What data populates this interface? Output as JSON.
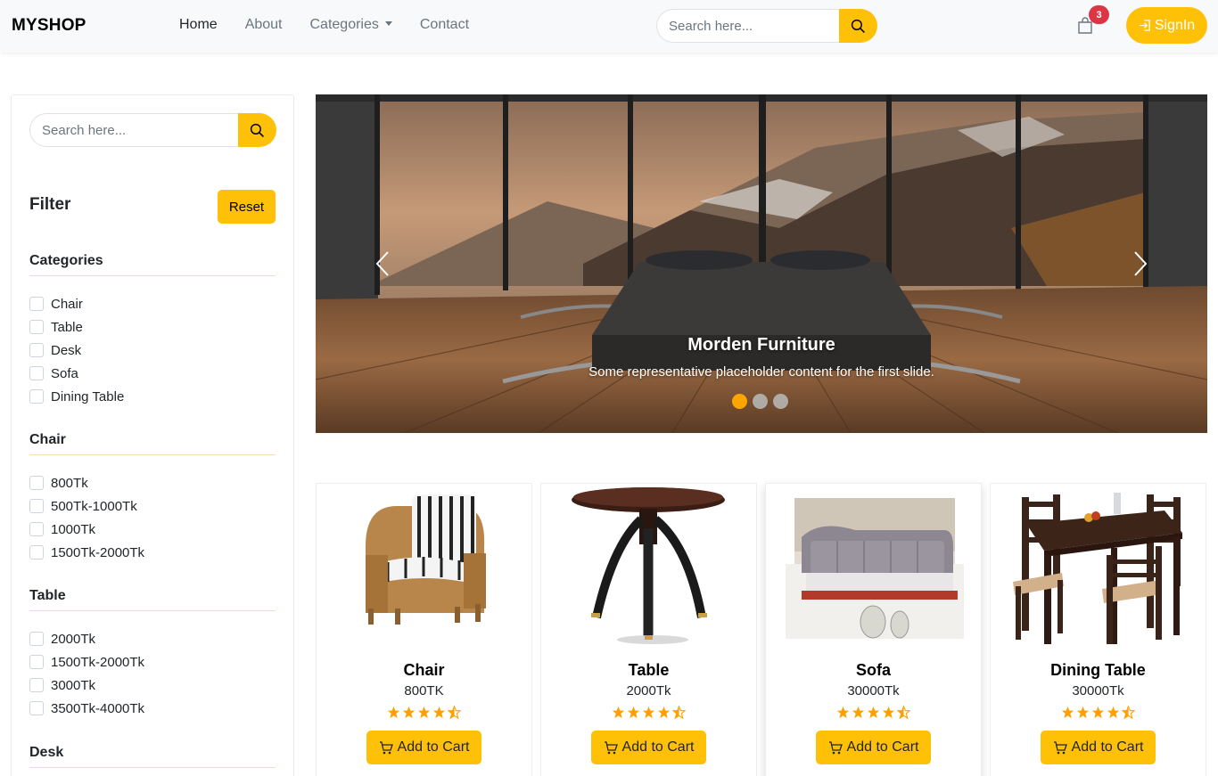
{
  "navbar": {
    "brand": "MYSHOP",
    "links": [
      {
        "label": "Home",
        "active": true
      },
      {
        "label": "About"
      },
      {
        "label": "Categories",
        "dropdown": true
      },
      {
        "label": "Contact"
      }
    ],
    "search": {
      "placeholder": "Search here...",
      "value": ""
    },
    "cart_count": "3",
    "signin_label": "SignIn"
  },
  "sidebar": {
    "search": {
      "placeholder": "Search here..."
    },
    "filter_title": "Filter",
    "reset_label": "Reset",
    "sections": [
      {
        "title": "Categories",
        "options": [
          "Chair",
          "Table",
          "Desk",
          "Sofa",
          "Dining Table"
        ]
      },
      {
        "title": "Chair",
        "options": [
          "800Tk",
          "500Tk-1000Tk",
          "1000Tk",
          "1500Tk-2000Tk"
        ]
      },
      {
        "title": "Table",
        "options": [
          "2000Tk",
          "1500Tk-2000Tk",
          "3000Tk",
          "3500Tk-4000Tk"
        ]
      },
      {
        "title": "Desk",
        "options": []
      }
    ]
  },
  "carousel": {
    "title": "Morden Furniture",
    "caption": "Some representative placeholder content for the first slide.",
    "active_slide": 0,
    "slide_count": 3
  },
  "products": [
    {
      "name": "Chair",
      "price": "800TK",
      "rating": 4.5,
      "button": "Add to Cart"
    },
    {
      "name": "Table",
      "price": "2000Tk",
      "rating": 4.5,
      "button": "Add to Cart"
    },
    {
      "name": "Sofa",
      "price": "30000Tk",
      "rating": 4.5,
      "button": "Add to Cart"
    },
    {
      "name": "Dining Table",
      "price": "30000Tk",
      "rating": 4.5,
      "button": "Add to Cart"
    }
  ],
  "colors": {
    "accent": "#ffc107",
    "badge": "#dc3545",
    "star": "#ffa000",
    "indicator_active": "#ffa500"
  }
}
